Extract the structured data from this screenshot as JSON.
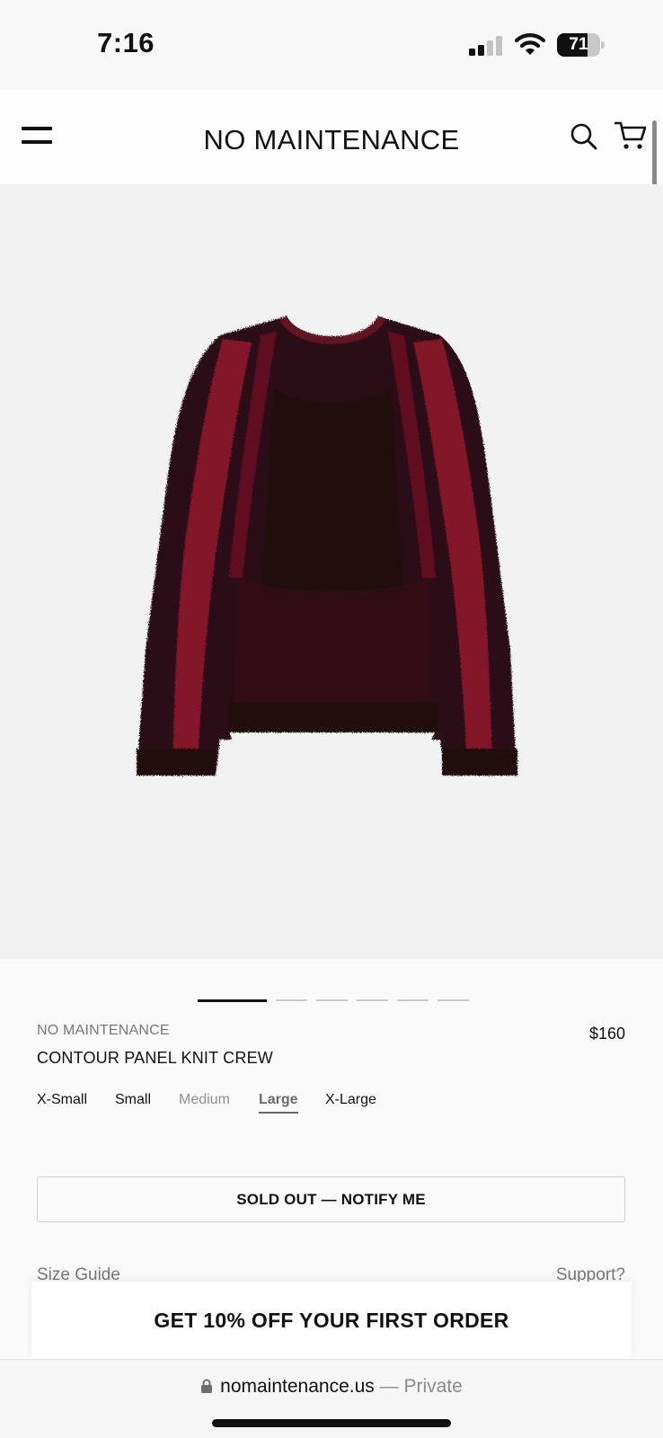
{
  "status_bar": {
    "time": "7:16",
    "battery": "71",
    "battery_level_percent": 71
  },
  "header": {
    "brand": "NO MAINTENANCE",
    "menu_icon": "hamburger-menu-icon",
    "search_icon": "search-icon",
    "cart_icon": "cart-icon"
  },
  "product_image": {
    "subject": "sweater-image"
  },
  "carousel": {
    "total": 6,
    "active_index": 1
  },
  "product": {
    "brand": "NO MAINTENANCE",
    "name": "CONTOUR PANEL KNIT CREW",
    "price": "$160",
    "sizes": [
      {
        "label": "X-Small",
        "state": "available"
      },
      {
        "label": "Small",
        "state": "available"
      },
      {
        "label": "Medium",
        "state": "unavailable"
      },
      {
        "label": "Large",
        "state": "selected"
      },
      {
        "label": "X-Large",
        "state": "available"
      }
    ],
    "notify_button": "SOLD OUT — NOTIFY ME",
    "size_guide": "Size Guide",
    "support": "Support?"
  },
  "promo": {
    "text": "GET 10% OFF YOUR FIRST ORDER"
  },
  "browser": {
    "domain": "nomaintenance.us",
    "mode": "— Private"
  },
  "colors": {
    "sweater_dark": "#2a0a12",
    "sweater_red": "#8e1430",
    "background": "#f2f2f3",
    "text": "#111111"
  }
}
